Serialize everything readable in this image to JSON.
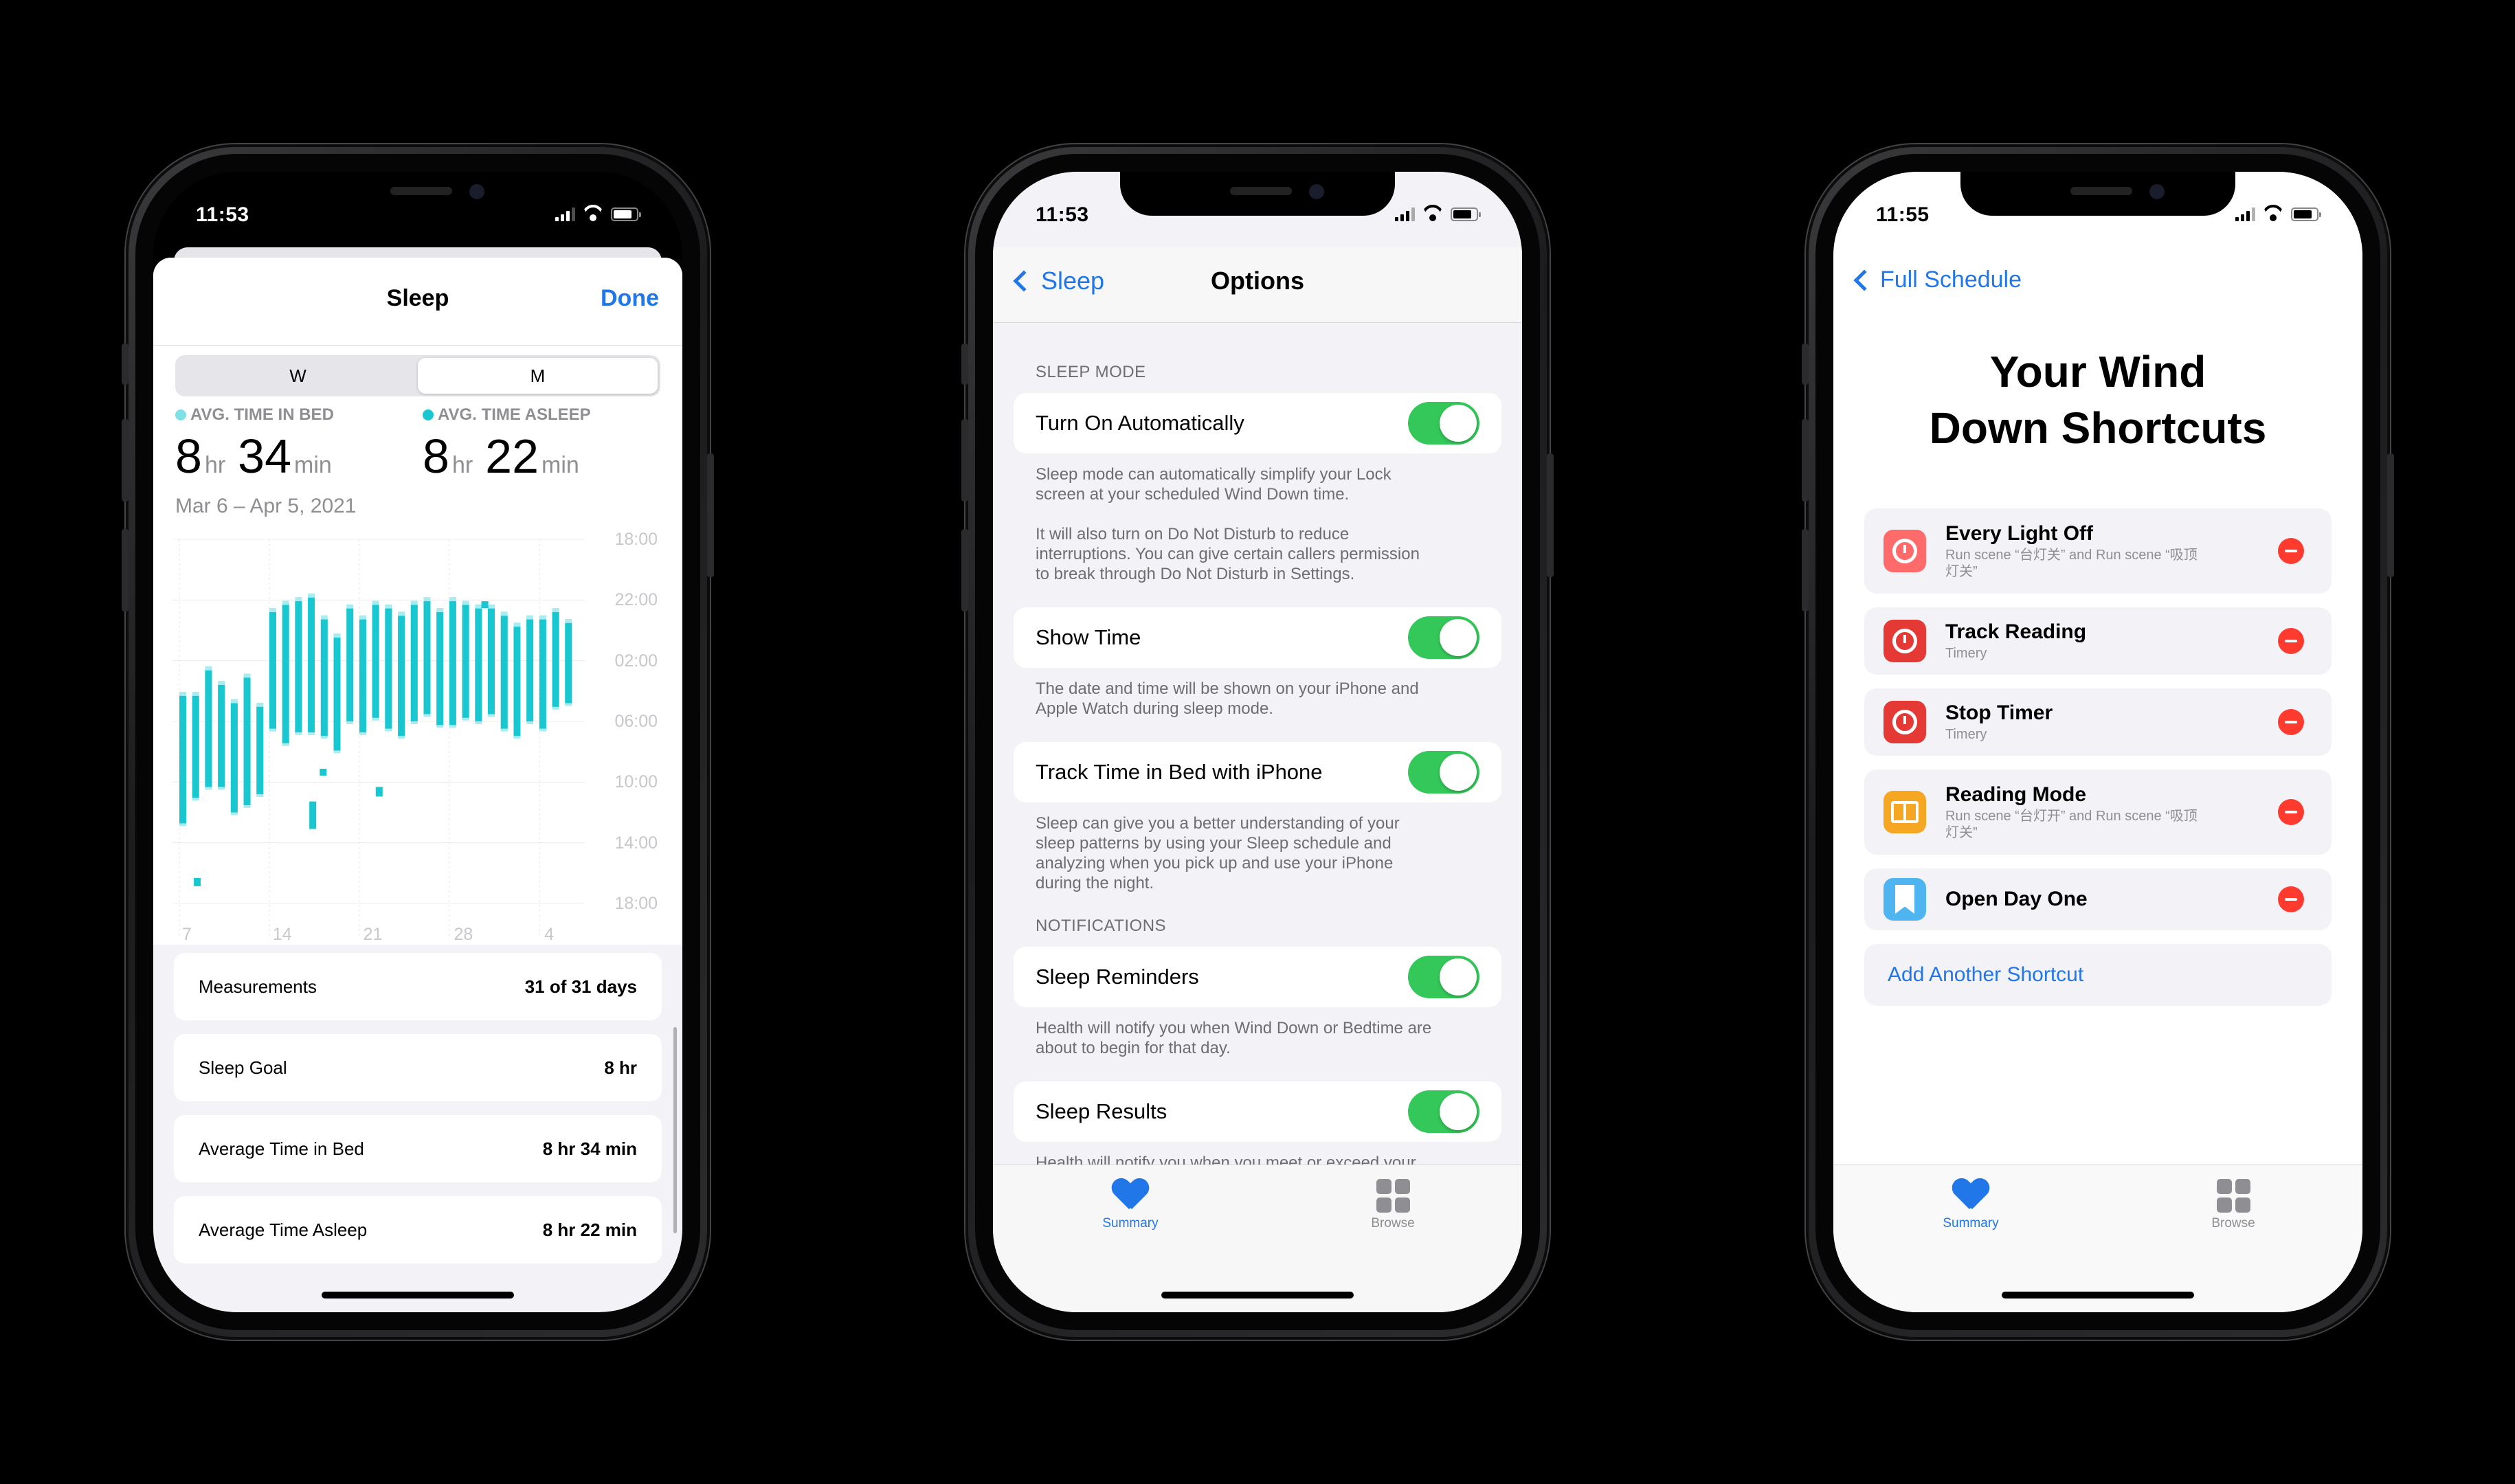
{
  "phone1": {
    "status_time": "11:53",
    "sheet_title": "Sleep",
    "done_label": "Done",
    "segments": [
      "W",
      "M"
    ],
    "selected_segment": "M",
    "stat_bed": {
      "label": "AVG. TIME IN BED",
      "hours": "8",
      "hr": "hr",
      "minutes": "34",
      "min": "min",
      "dot_color": "#7fe0e6"
    },
    "stat_asleep": {
      "label": "AVG. TIME ASLEEP",
      "hours": "8",
      "hr": "hr",
      "minutes": "22",
      "min": "min",
      "dot_color": "#18c7cf"
    },
    "date_range": "Mar 6 – Apr 5, 2021",
    "chart_data": {
      "type": "bar",
      "y_labels": [
        "18:00",
        "22:00",
        "02:00",
        "06:00",
        "10:00",
        "14:00",
        "18:00"
      ],
      "x_labels": [
        "7",
        "14",
        "21",
        "28",
        "4"
      ],
      "colors": {
        "asleep": "#18c7cf",
        "in_bed": "#a8ecef"
      }
    },
    "rows": [
      {
        "label": "Measurements",
        "value": "31 of 31 days"
      },
      {
        "label": "Sleep Goal",
        "value": "8 hr"
      },
      {
        "label": "Average Time in Bed",
        "value": "8 hr 34 min"
      },
      {
        "label": "Average Time Asleep",
        "value": "8 hr 22 min"
      }
    ]
  },
  "phone2": {
    "status_time": "11:53",
    "back_label": "Sleep",
    "title": "Options",
    "sections": [
      {
        "header": "SLEEP MODE",
        "items": [
          {
            "label": "Turn On Automatically",
            "on": true,
            "footer": "Sleep mode can automatically simplify your Lock\nscreen at your scheduled Wind Down time.\n\nIt will also turn on Do Not Disturb to reduce\ninterruptions. You can give certain callers permission\nto break through Do Not Disturb in Settings."
          },
          {
            "label": "Show Time",
            "on": true,
            "footer": "The date and time will be shown on your iPhone and\nApple Watch during sleep mode."
          },
          {
            "label": "Track Time in Bed with iPhone",
            "on": true,
            "footer": "Sleep can give you a better understanding of your\nsleep patterns by using your Sleep schedule and\nanalyzing when you pick up and use your iPhone\nduring the night."
          }
        ]
      },
      {
        "header": "NOTIFICATIONS",
        "items": [
          {
            "label": "Sleep Reminders",
            "on": true,
            "footer": "Health will notify you when Wind Down or Bedtime are\nabout to begin for that day."
          },
          {
            "label": "Sleep Results",
            "on": true,
            "footer": "Health will notify you when you meet or exceed your\nsleep goal. This requires sleep data from Apple Watch"
          }
        ]
      }
    ],
    "tabs": [
      {
        "label": "Summary",
        "active": true
      },
      {
        "label": "Browse",
        "active": false
      }
    ]
  },
  "phone3": {
    "status_time": "11:55",
    "back_label": "Full Schedule",
    "title_line1": "Your Wind",
    "title_line2": "Down Shortcuts",
    "shortcuts": [
      {
        "name": "Every Light Off",
        "sub": "Run scene “台灯关” and Run scene “吸顶\n灯关”",
        "icon": "power-icon",
        "color": "#ff6b6b"
      },
      {
        "name": "Track Reading",
        "sub": "Timery",
        "icon": "timer-icon",
        "color": "#e53935"
      },
      {
        "name": "Stop Timer",
        "sub": "Timery",
        "icon": "timer-icon",
        "color": "#e53935"
      },
      {
        "name": "Reading Mode",
        "sub": "Run scene “台灯开” and Run scene “吸顶\n灯关”",
        "icon": "book-icon",
        "color": "#f5a623"
      },
      {
        "name": "Open Day One",
        "sub": "",
        "icon": "bookmark-icon",
        "color": "#4fb5f0"
      }
    ],
    "add_label": "Add Another Shortcut",
    "tabs": [
      {
        "label": "Summary",
        "active": true
      },
      {
        "label": "Browse",
        "active": false
      }
    ]
  }
}
